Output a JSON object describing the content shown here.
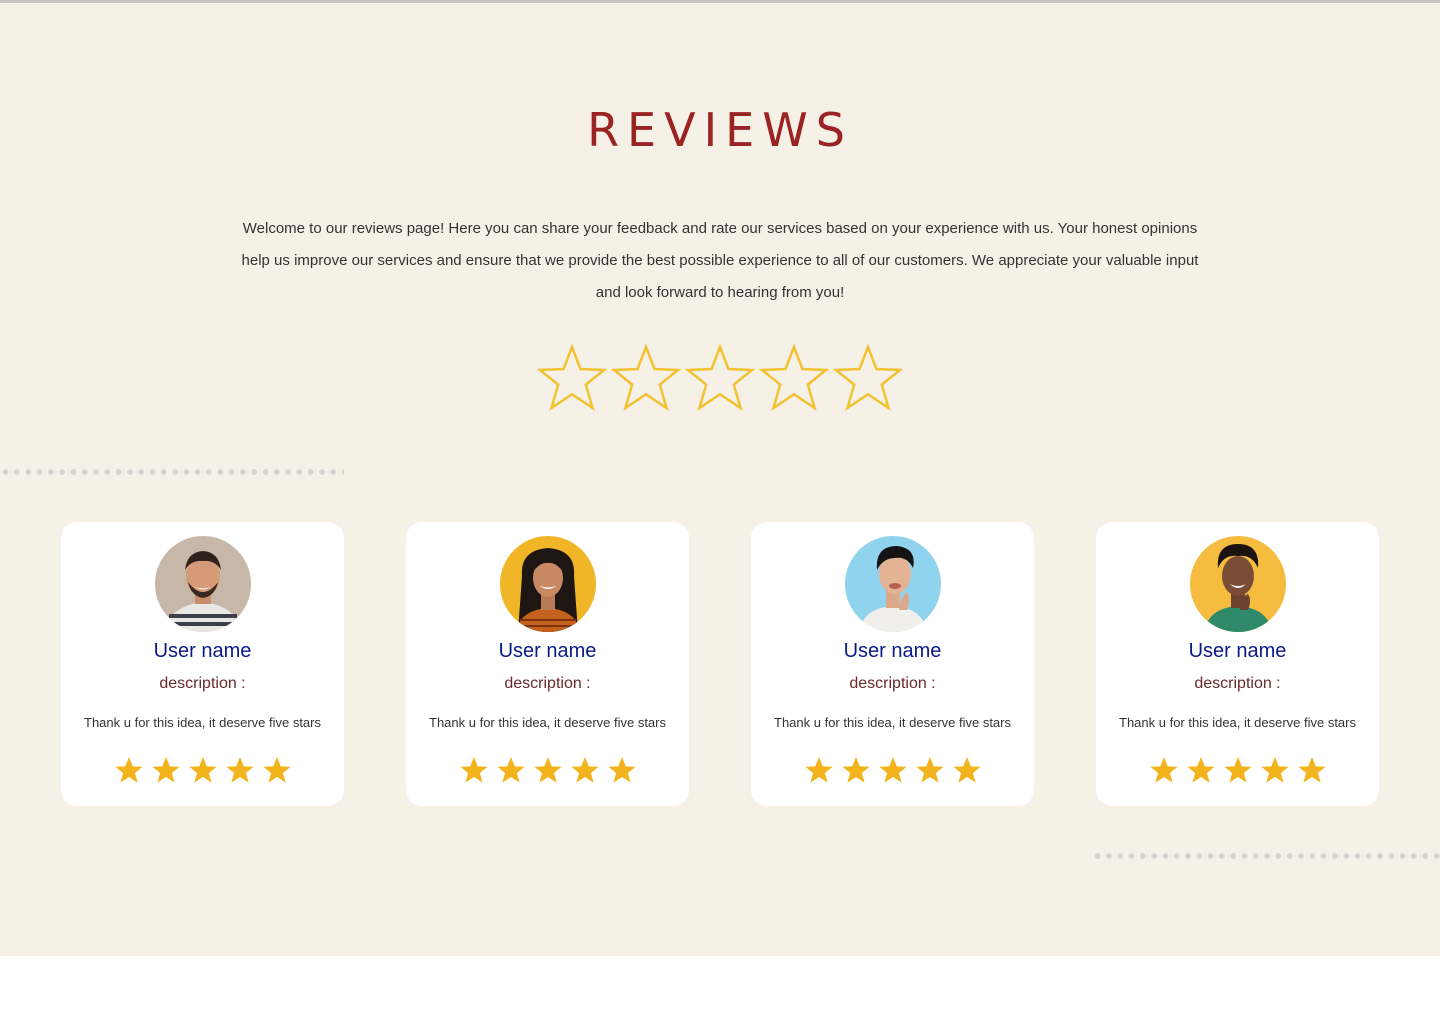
{
  "reviews_section": {
    "title": "REVIEWS",
    "intro": "Welcome to our reviews page! Here you can share your feedback and rate our services based on your experience with us. Your honest opinions help us improve our services and ensure that we provide the best possible experience to all of our customers. We appreciate your valuable input and look forward to hearing from you!",
    "rating_input": {
      "max_stars": 5,
      "selected": 0,
      "star_icon": "star-outline-icon",
      "star_color": "#f2c231"
    }
  },
  "cards": [
    {
      "user_name": "User name",
      "description_label": "description :",
      "review": "Thank u for this idea, it deserve five stars",
      "rating": 5,
      "avatar_bg": "#c7b7a8"
    },
    {
      "user_name": "User name",
      "description_label": "description :",
      "review": "Thank u for this idea, it deserve five stars",
      "rating": 5,
      "avatar_bg": "#f0b627"
    },
    {
      "user_name": "User name",
      "description_label": "description :",
      "review": "Thank u for this idea, it deserve five stars",
      "rating": 5,
      "avatar_bg": "#8fd3ee"
    },
    {
      "user_name": "User name",
      "description_label": "description :",
      "review": "Thank u for this idea, it deserve five stars",
      "rating": 5,
      "avatar_bg": "#f5bc3f"
    }
  ],
  "colors": {
    "background": "#f5f1e6",
    "title": "#9a2323",
    "user_name": "#0a1a88",
    "star_filled": "#f2b31c"
  }
}
